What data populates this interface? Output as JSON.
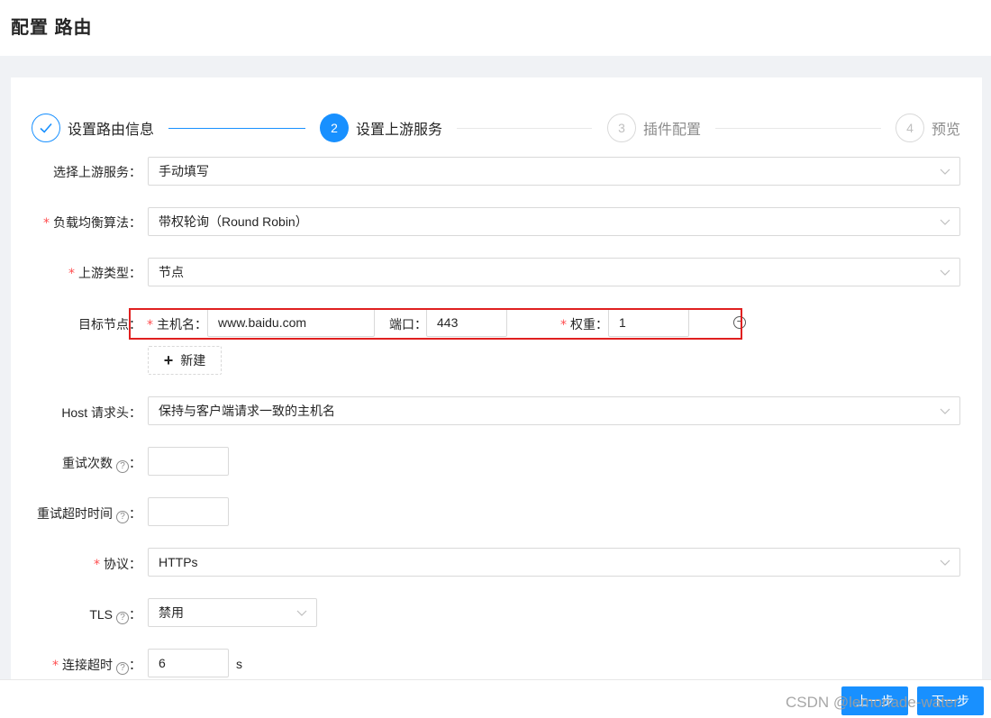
{
  "page": {
    "title": "配置 路由"
  },
  "steps": [
    {
      "number": "",
      "label": "设置路由信息",
      "status": "done"
    },
    {
      "number": "2",
      "label": "设置上游服务",
      "status": "active"
    },
    {
      "number": "3",
      "label": "插件配置",
      "status": "wait"
    },
    {
      "number": "4",
      "label": "预览",
      "status": "wait"
    }
  ],
  "form": {
    "upstream_select": {
      "label": "选择上游服务",
      "value": "手动填写"
    },
    "lb_algorithm": {
      "label": "负载均衡算法",
      "value": "带权轮询（Round Robin）"
    },
    "upstream_type": {
      "label": "上游类型",
      "value": "节点"
    },
    "target_nodes": {
      "label": "目标节点",
      "host_label": "主机名",
      "host_value": "www.baidu.com",
      "port_label": "端口",
      "port_value": "443",
      "weight_label": "权重",
      "weight_value": "1",
      "new_button": "新建"
    },
    "host_header": {
      "label": "Host 请求头",
      "value": "保持与客户端请求一致的主机名"
    },
    "retries": {
      "label": "重试次数",
      "value": ""
    },
    "retry_timeout": {
      "label": "重试超时时间",
      "value": ""
    },
    "protocol": {
      "label": "协议",
      "value": "HTTPs"
    },
    "tls": {
      "label": "TLS",
      "value": "禁用"
    },
    "connect_timeout": {
      "label": "连接超时",
      "value": "6",
      "unit": "s"
    }
  },
  "footer": {
    "prev_label": "上一步",
    "next_label": "下一步"
  },
  "watermark": "CSDN @lemonade-water",
  "colors": {
    "primary": "#1890ff",
    "required": "#ff4d4f",
    "highlight": "#e02020"
  }
}
